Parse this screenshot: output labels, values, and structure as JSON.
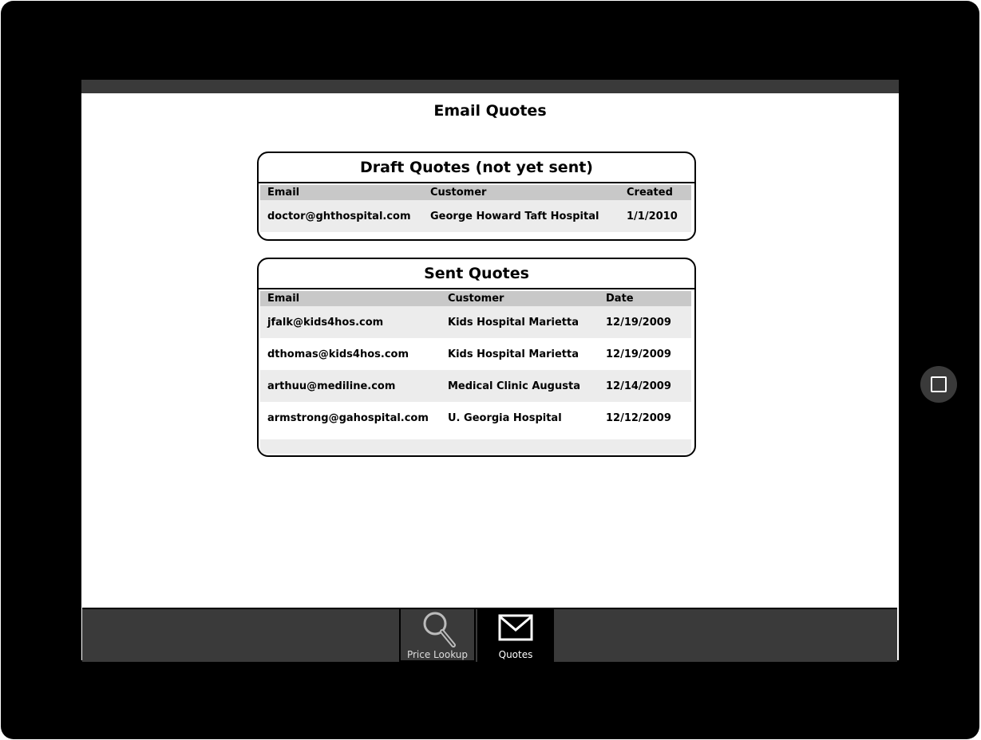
{
  "page": {
    "title": "Email Quotes"
  },
  "draft_quotes": {
    "title": "Draft Quotes (not yet sent)",
    "columns": [
      "Email",
      "Customer",
      "Created"
    ],
    "rows": [
      {
        "email": "doctor@ghthospital.com",
        "customer": "George Howard Taft Hospital",
        "created": "1/1/2010"
      }
    ]
  },
  "sent_quotes": {
    "title": "Sent Quotes",
    "columns": [
      "Email",
      "Customer",
      "Date"
    ],
    "rows": [
      {
        "email": "jfalk@kids4hos.com",
        "customer": "Kids Hospital Marietta",
        "date": "12/19/2009"
      },
      {
        "email": "dthomas@kids4hos.com",
        "customer": "Kids Hospital Marietta",
        "date": "12/19/2009"
      },
      {
        "email": "arthuu@mediline.com",
        "customer": "Medical Clinic Augusta",
        "date": "12/14/2009"
      },
      {
        "email": "armstrong@gahospital.com",
        "customer": "U. Georgia Hospital",
        "date": "12/12/2009"
      }
    ]
  },
  "tab_bar": {
    "tabs": [
      {
        "label": "Price Lookup",
        "icon": "search-icon",
        "selected": false
      },
      {
        "label": "Quotes",
        "icon": "envelope-icon",
        "selected": true
      }
    ]
  },
  "device": {
    "home_button_icon": "square-icon"
  },
  "colors": {
    "frame": "#000000",
    "bar": "#3a3a3a",
    "header_row": "#c8c8c8",
    "stripe_row": "#ececec"
  }
}
